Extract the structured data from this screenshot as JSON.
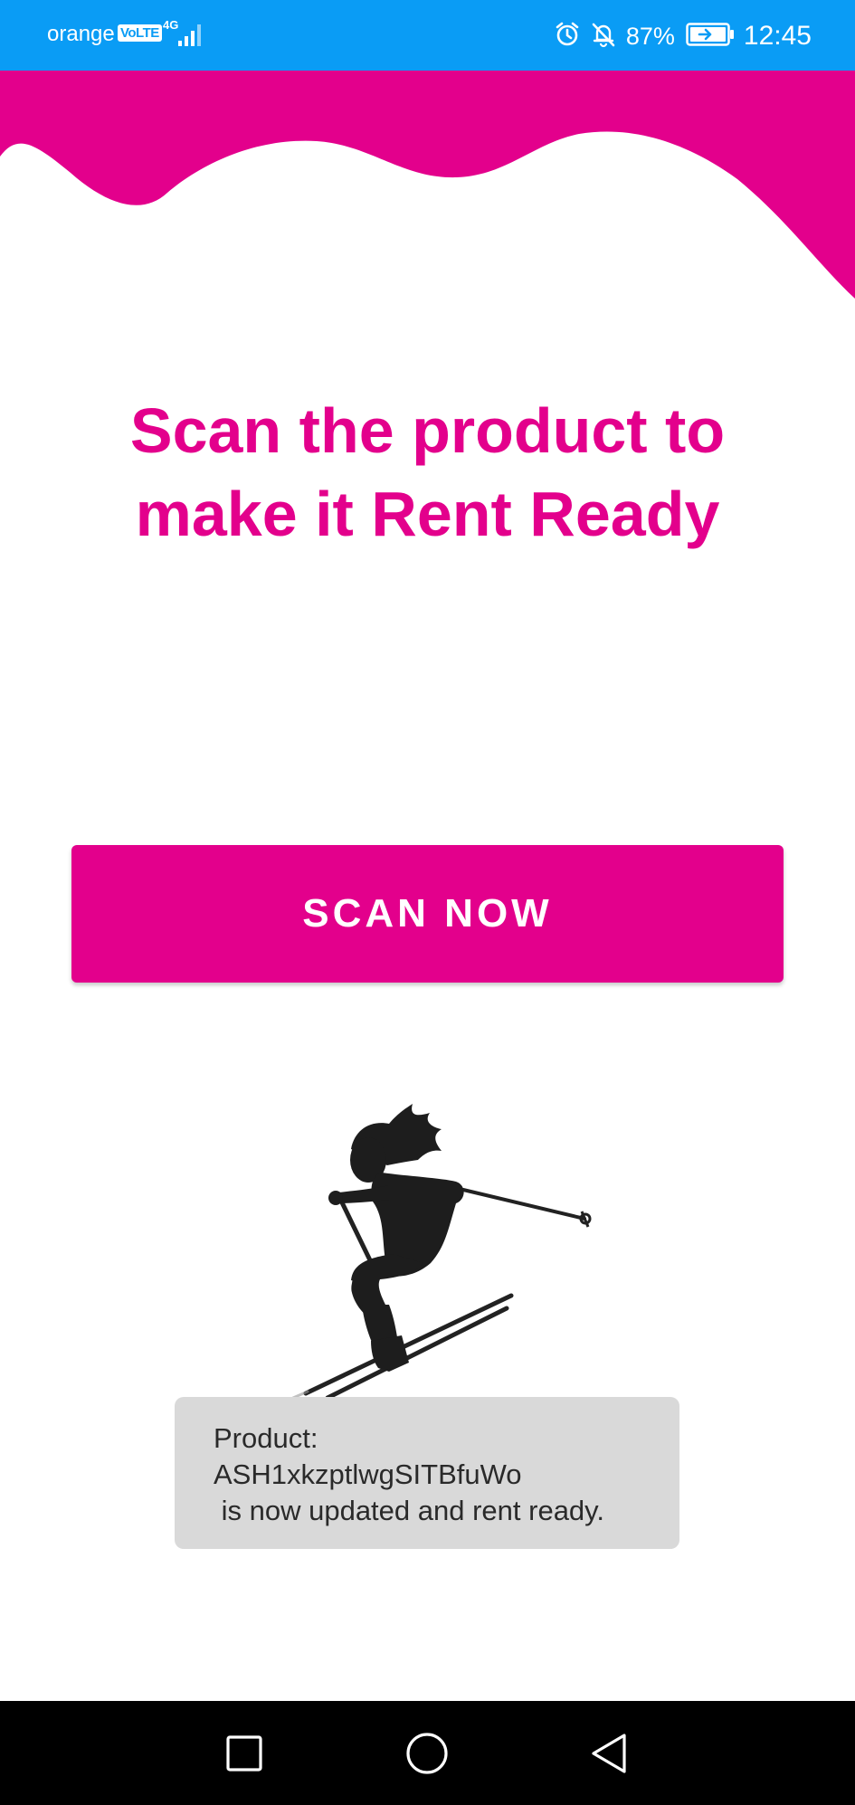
{
  "status_bar": {
    "carrier": "orange",
    "volte": "VoLTE",
    "network": "4G",
    "battery": "87%",
    "time": "12:45",
    "icons": [
      "signal-icon",
      "alarm-icon",
      "bell-off-icon",
      "battery-charging-icon"
    ]
  },
  "main": {
    "headline_line1": "Scan the product to",
    "headline_line2": "make it Rent Ready",
    "scan_button_label": "SCAN NOW"
  },
  "toast": {
    "line1": "Product:",
    "line2": "ASH1xkzptlwgSITBfuWo",
    "line3": " is now updated and rent ready."
  },
  "nav_bar": {
    "icons": [
      "recents-square-icon",
      "home-circle-icon",
      "back-triangle-icon"
    ]
  },
  "colors": {
    "accent": "#e3008c",
    "status_bar": "#0a9cf5",
    "toast_bg": "#d9d9d9",
    "nav_bar": "#000000"
  }
}
